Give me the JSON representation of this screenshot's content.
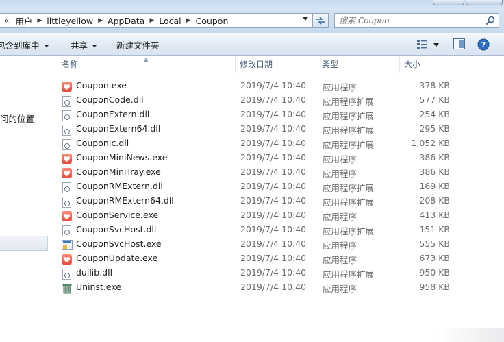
{
  "address_bar": {
    "lead": "«",
    "crumbs": [
      "用户",
      "littleyellow",
      "AppData",
      "Local",
      "Coupon"
    ]
  },
  "search": {
    "placeholder": "搜索 Coupon"
  },
  "command_bar": {
    "include_in_library": "包含到库中",
    "share": "共享",
    "new_folder": "新建文件夹"
  },
  "nav_pane": {
    "recent_places_fragment": "问的位置"
  },
  "columns": {
    "name": "名称",
    "date": "修改日期",
    "type": "类型",
    "size": "大小"
  },
  "files": [
    {
      "name": "Coupon.exe",
      "date": "2019/7/4 10:40",
      "type": "应用程序",
      "size": "378 KB",
      "icon": "app"
    },
    {
      "name": "CouponCode.dll",
      "date": "2019/7/4 10:40",
      "type": "应用程序扩展",
      "size": "577 KB",
      "icon": "dll"
    },
    {
      "name": "CouponExtern.dll",
      "date": "2019/7/4 10:40",
      "type": "应用程序扩展",
      "size": "254 KB",
      "icon": "dll"
    },
    {
      "name": "CouponExtern64.dll",
      "date": "2019/7/4 10:40",
      "type": "应用程序扩展",
      "size": "295 KB",
      "icon": "dll"
    },
    {
      "name": "CouponIc.dll",
      "date": "2019/7/4 10:40",
      "type": "应用程序扩展",
      "size": "1,052 KB",
      "icon": "dll"
    },
    {
      "name": "CouponMiniNews.exe",
      "date": "2019/7/4 10:40",
      "type": "应用程序",
      "size": "386 KB",
      "icon": "app"
    },
    {
      "name": "CouponMiniTray.exe",
      "date": "2019/7/4 10:40",
      "type": "应用程序",
      "size": "386 KB",
      "icon": "app"
    },
    {
      "name": "CouponRMExtern.dll",
      "date": "2019/7/4 10:40",
      "type": "应用程序扩展",
      "size": "169 KB",
      "icon": "dll"
    },
    {
      "name": "CouponRMExtern64.dll",
      "date": "2019/7/4 10:40",
      "type": "应用程序扩展",
      "size": "208 KB",
      "icon": "dll"
    },
    {
      "name": "CouponService.exe",
      "date": "2019/7/4 10:40",
      "type": "应用程序",
      "size": "413 KB",
      "icon": "app"
    },
    {
      "name": "CouponSvcHost.dll",
      "date": "2019/7/4 10:40",
      "type": "应用程序扩展",
      "size": "151 KB",
      "icon": "dll"
    },
    {
      "name": "CouponSvcHost.exe",
      "date": "2019/7/4 10:40",
      "type": "应用程序",
      "size": "555 KB",
      "icon": "svc"
    },
    {
      "name": "CouponUpdate.exe",
      "date": "2019/7/4 10:40",
      "type": "应用程序",
      "size": "673 KB",
      "icon": "app"
    },
    {
      "name": "duilib.dll",
      "date": "2019/7/4 10:40",
      "type": "应用程序扩展",
      "size": "950 KB",
      "icon": "dll"
    },
    {
      "name": "Uninst.exe",
      "date": "2019/7/4 10:40",
      "type": "应用程序",
      "size": "958 KB",
      "icon": "uninst"
    }
  ],
  "colors": {
    "app_icon": "#e94b3c",
    "chrome_blue": "#c7daee",
    "secondary_text": "#6d6d6d"
  }
}
